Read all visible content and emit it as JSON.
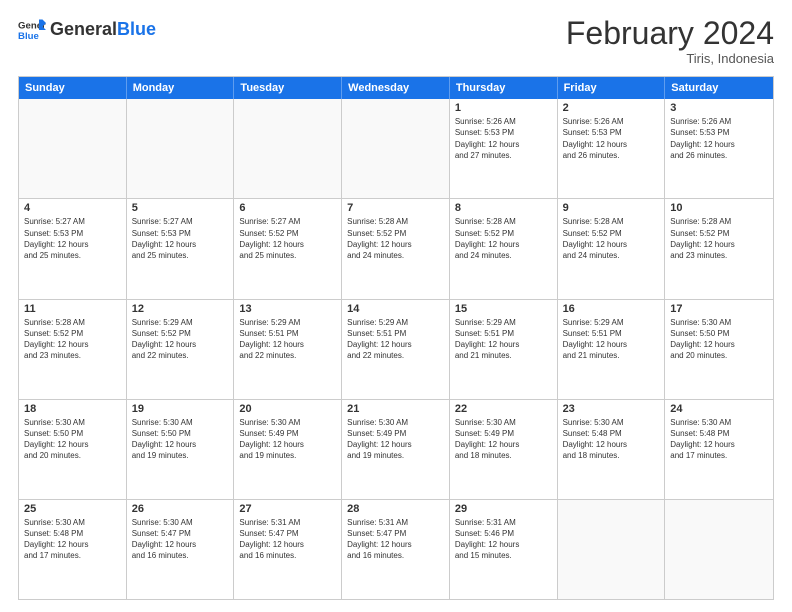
{
  "logo": {
    "text_general": "General",
    "text_blue": "Blue"
  },
  "header": {
    "month": "February 2024",
    "location": "Tiris, Indonesia"
  },
  "days_of_week": [
    "Sunday",
    "Monday",
    "Tuesday",
    "Wednesday",
    "Thursday",
    "Friday",
    "Saturday"
  ],
  "weeks": [
    [
      {
        "day": "",
        "info": ""
      },
      {
        "day": "",
        "info": ""
      },
      {
        "day": "",
        "info": ""
      },
      {
        "day": "",
        "info": ""
      },
      {
        "day": "1",
        "info": "Sunrise: 5:26 AM\nSunset: 5:53 PM\nDaylight: 12 hours\nand 27 minutes."
      },
      {
        "day": "2",
        "info": "Sunrise: 5:26 AM\nSunset: 5:53 PM\nDaylight: 12 hours\nand 26 minutes."
      },
      {
        "day": "3",
        "info": "Sunrise: 5:26 AM\nSunset: 5:53 PM\nDaylight: 12 hours\nand 26 minutes."
      }
    ],
    [
      {
        "day": "4",
        "info": "Sunrise: 5:27 AM\nSunset: 5:53 PM\nDaylight: 12 hours\nand 25 minutes."
      },
      {
        "day": "5",
        "info": "Sunrise: 5:27 AM\nSunset: 5:53 PM\nDaylight: 12 hours\nand 25 minutes."
      },
      {
        "day": "6",
        "info": "Sunrise: 5:27 AM\nSunset: 5:52 PM\nDaylight: 12 hours\nand 25 minutes."
      },
      {
        "day": "7",
        "info": "Sunrise: 5:28 AM\nSunset: 5:52 PM\nDaylight: 12 hours\nand 24 minutes."
      },
      {
        "day": "8",
        "info": "Sunrise: 5:28 AM\nSunset: 5:52 PM\nDaylight: 12 hours\nand 24 minutes."
      },
      {
        "day": "9",
        "info": "Sunrise: 5:28 AM\nSunset: 5:52 PM\nDaylight: 12 hours\nand 24 minutes."
      },
      {
        "day": "10",
        "info": "Sunrise: 5:28 AM\nSunset: 5:52 PM\nDaylight: 12 hours\nand 23 minutes."
      }
    ],
    [
      {
        "day": "11",
        "info": "Sunrise: 5:28 AM\nSunset: 5:52 PM\nDaylight: 12 hours\nand 23 minutes."
      },
      {
        "day": "12",
        "info": "Sunrise: 5:29 AM\nSunset: 5:52 PM\nDaylight: 12 hours\nand 22 minutes."
      },
      {
        "day": "13",
        "info": "Sunrise: 5:29 AM\nSunset: 5:51 PM\nDaylight: 12 hours\nand 22 minutes."
      },
      {
        "day": "14",
        "info": "Sunrise: 5:29 AM\nSunset: 5:51 PM\nDaylight: 12 hours\nand 22 minutes."
      },
      {
        "day": "15",
        "info": "Sunrise: 5:29 AM\nSunset: 5:51 PM\nDaylight: 12 hours\nand 21 minutes."
      },
      {
        "day": "16",
        "info": "Sunrise: 5:29 AM\nSunset: 5:51 PM\nDaylight: 12 hours\nand 21 minutes."
      },
      {
        "day": "17",
        "info": "Sunrise: 5:30 AM\nSunset: 5:50 PM\nDaylight: 12 hours\nand 20 minutes."
      }
    ],
    [
      {
        "day": "18",
        "info": "Sunrise: 5:30 AM\nSunset: 5:50 PM\nDaylight: 12 hours\nand 20 minutes."
      },
      {
        "day": "19",
        "info": "Sunrise: 5:30 AM\nSunset: 5:50 PM\nDaylight: 12 hours\nand 19 minutes."
      },
      {
        "day": "20",
        "info": "Sunrise: 5:30 AM\nSunset: 5:49 PM\nDaylight: 12 hours\nand 19 minutes."
      },
      {
        "day": "21",
        "info": "Sunrise: 5:30 AM\nSunset: 5:49 PM\nDaylight: 12 hours\nand 19 minutes."
      },
      {
        "day": "22",
        "info": "Sunrise: 5:30 AM\nSunset: 5:49 PM\nDaylight: 12 hours\nand 18 minutes."
      },
      {
        "day": "23",
        "info": "Sunrise: 5:30 AM\nSunset: 5:48 PM\nDaylight: 12 hours\nand 18 minutes."
      },
      {
        "day": "24",
        "info": "Sunrise: 5:30 AM\nSunset: 5:48 PM\nDaylight: 12 hours\nand 17 minutes."
      }
    ],
    [
      {
        "day": "25",
        "info": "Sunrise: 5:30 AM\nSunset: 5:48 PM\nDaylight: 12 hours\nand 17 minutes."
      },
      {
        "day": "26",
        "info": "Sunrise: 5:30 AM\nSunset: 5:47 PM\nDaylight: 12 hours\nand 16 minutes."
      },
      {
        "day": "27",
        "info": "Sunrise: 5:31 AM\nSunset: 5:47 PM\nDaylight: 12 hours\nand 16 minutes."
      },
      {
        "day": "28",
        "info": "Sunrise: 5:31 AM\nSunset: 5:47 PM\nDaylight: 12 hours\nand 16 minutes."
      },
      {
        "day": "29",
        "info": "Sunrise: 5:31 AM\nSunset: 5:46 PM\nDaylight: 12 hours\nand 15 minutes."
      },
      {
        "day": "",
        "info": ""
      },
      {
        "day": "",
        "info": ""
      }
    ]
  ]
}
